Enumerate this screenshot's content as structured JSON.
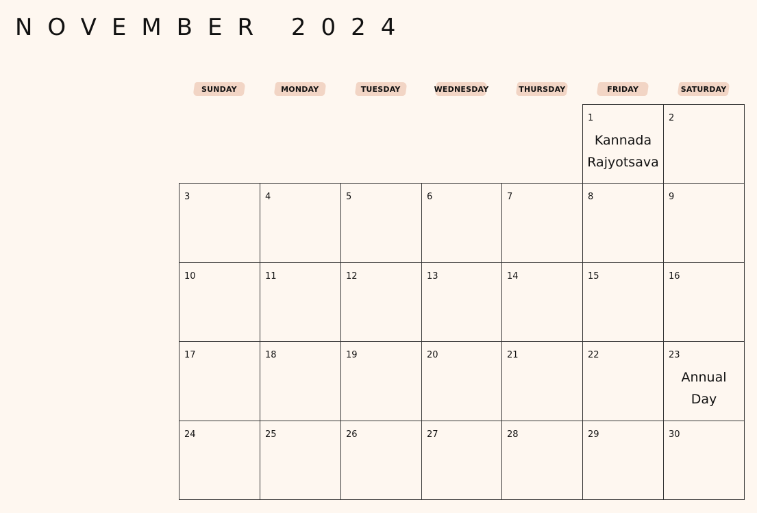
{
  "title": "NOVEMBER 2024",
  "weekdays": [
    "SUNDAY",
    "MONDAY",
    "TUESDAY",
    "WEDNESDAY",
    "THURSDAY",
    "FRIDAY",
    "SATURDAY"
  ],
  "weeks": [
    [
      {
        "day": "",
        "event": ""
      },
      {
        "day": "",
        "event": ""
      },
      {
        "day": "",
        "event": ""
      },
      {
        "day": "",
        "event": ""
      },
      {
        "day": "",
        "event": ""
      },
      {
        "day": "1",
        "event": "Kannada Rajyotsava"
      },
      {
        "day": "2",
        "event": ""
      }
    ],
    [
      {
        "day": "3",
        "event": ""
      },
      {
        "day": "4",
        "event": ""
      },
      {
        "day": "5",
        "event": ""
      },
      {
        "day": "6",
        "event": ""
      },
      {
        "day": "7",
        "event": ""
      },
      {
        "day": "8",
        "event": ""
      },
      {
        "day": "9",
        "event": ""
      }
    ],
    [
      {
        "day": "10",
        "event": ""
      },
      {
        "day": "11",
        "event": ""
      },
      {
        "day": "12",
        "event": ""
      },
      {
        "day": "13",
        "event": ""
      },
      {
        "day": "14",
        "event": ""
      },
      {
        "day": "15",
        "event": ""
      },
      {
        "day": "16",
        "event": ""
      }
    ],
    [
      {
        "day": "17",
        "event": ""
      },
      {
        "day": "18",
        "event": ""
      },
      {
        "day": "19",
        "event": ""
      },
      {
        "day": "20",
        "event": ""
      },
      {
        "day": "21",
        "event": ""
      },
      {
        "day": "22",
        "event": ""
      },
      {
        "day": "23",
        "event": "Annual Day"
      }
    ],
    [
      {
        "day": "24",
        "event": ""
      },
      {
        "day": "25",
        "event": ""
      },
      {
        "day": "26",
        "event": ""
      },
      {
        "day": "27",
        "event": ""
      },
      {
        "day": "28",
        "event": ""
      },
      {
        "day": "29",
        "event": ""
      },
      {
        "day": "30",
        "event": ""
      }
    ]
  ],
  "colors": {
    "background": "#fef7f0",
    "weekday_highlight": "#f2d5c5",
    "grid_line": "#333333",
    "text": "#111111"
  }
}
